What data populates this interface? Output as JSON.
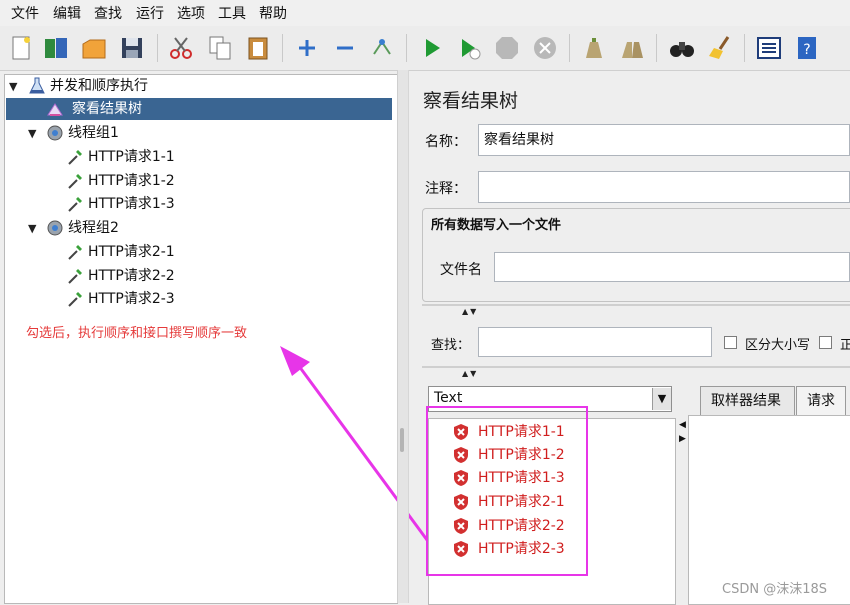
{
  "menu": [
    "文件",
    "编辑",
    "查找",
    "运行",
    "选项",
    "工具",
    "帮助"
  ],
  "tree": {
    "root": "并发和顺序执行",
    "selected": "察看结果树",
    "group1": "线程组1",
    "group1_items": [
      "HTTP请求1-1",
      "HTTP请求1-2",
      "HTTP请求1-3"
    ],
    "group2": "线程组2",
    "group2_items": [
      "HTTP请求2-1",
      "HTTP请求2-2",
      "HTTP请求2-3"
    ]
  },
  "annotation": "勾选后，执行顺序和接口撰写顺序一致",
  "panel": {
    "title": "察看结果树",
    "name_label": "名称：",
    "name_value": "察看结果树",
    "comment_label": "注释：",
    "file_group_title": "所有数据写入一个文件",
    "file_label": "文件名",
    "search_label": "查找：",
    "case_label": "区分大小写",
    "regex_label": "正"
  },
  "renderer": {
    "selected": "Text"
  },
  "results": [
    "HTTP请求1-1",
    "HTTP请求1-2",
    "HTTP请求1-3",
    "HTTP请求2-1",
    "HTTP请求2-2",
    "HTTP请求2-3"
  ],
  "tabs": [
    "取样器结果",
    "请求"
  ],
  "watermark": "CSDN @沫沫18S",
  "colors": {
    "selection": "#3a6592",
    "error_text": "#d01e1e",
    "annotation": "#e53a3a",
    "highlight": "#e735e8"
  }
}
